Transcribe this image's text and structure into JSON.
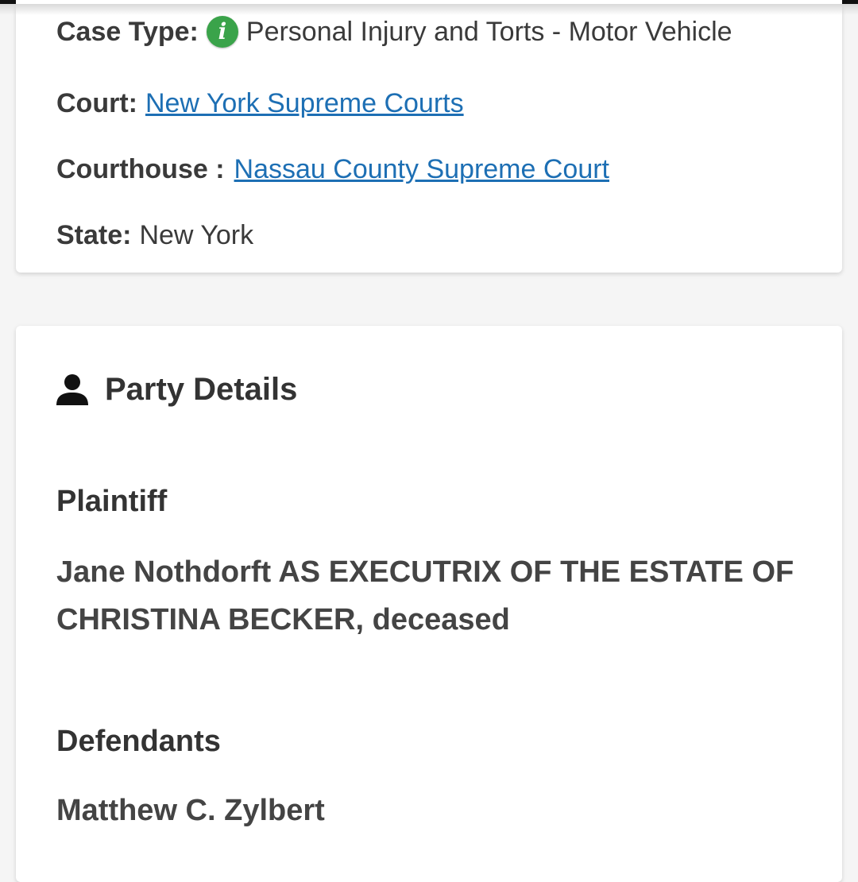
{
  "case_info": {
    "case_type_label": "Case Type:",
    "case_type_value": "Personal Injury and Torts - Motor Vehicle",
    "court_label": "Court:",
    "court_value": "New York Supreme Courts",
    "courthouse_label": "Courthouse :",
    "courthouse_value": "Nassau County Supreme Court",
    "state_label": "State:",
    "state_value": "New York",
    "info_icon": "info-icon",
    "info_color": "#3aa34a",
    "link_color": "#1d6fb4"
  },
  "party_details": {
    "title": "Party Details",
    "icon": "person-icon",
    "plaintiff_heading": "Plaintiff",
    "plaintiff_name": "Jane Nothdorft AS EXECUTRIX OF THE ESTATE OF CHRISTINA BECKER, deceased",
    "defendants_heading": "Defendants",
    "defendant_name": "Matthew C. Zylbert"
  }
}
